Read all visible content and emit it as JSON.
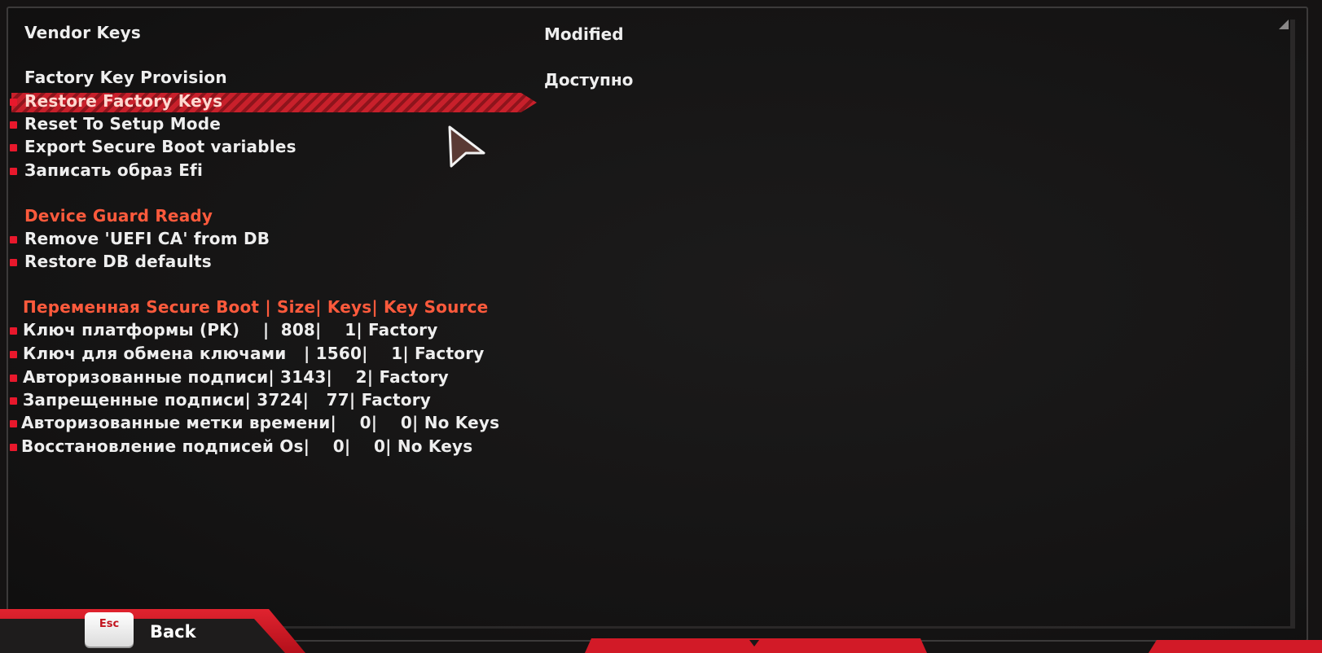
{
  "settings": {
    "vendor_keys": {
      "label": "Vendor Keys",
      "value": "Modified"
    },
    "factory_key_provision": {
      "label": "Factory Key Provision",
      "value": "Доступно"
    },
    "actions": [
      "Restore Factory Keys",
      "Reset To Setup Mode",
      "Export Secure Boot variables",
      "Записать образ Efi"
    ],
    "device_guard": {
      "heading": "Device Guard Ready",
      "actions": [
        "Remove 'UEFI CA' from DB",
        "Restore DB defaults"
      ]
    },
    "variables": {
      "heading": "Переменная Secure Boot |  Size| Keys| Key Source",
      "rows": [
        "Ключ платформы (PK)    |  808|    1| Factory",
        "Ключ для обмена ключами   | 1560|    1| Factory",
        "Авторизованные подписи| 3143|    2| Factory",
        "Запрещенные подписи| 3724|   77| Factory",
        "Авторизованные метки времени|    0|    0| No Keys",
        "Восстановление подписей Os|    0|    0| No Keys"
      ]
    }
  },
  "footer": {
    "esc_key": "Esc",
    "back_label": "Back"
  },
  "colors": {
    "accent": "#ff5a3c",
    "bullet": "#e8182c",
    "selection": "#c8202b"
  },
  "icons": [
    "scroll-up-icon",
    "mouse-pointer-icon"
  ]
}
